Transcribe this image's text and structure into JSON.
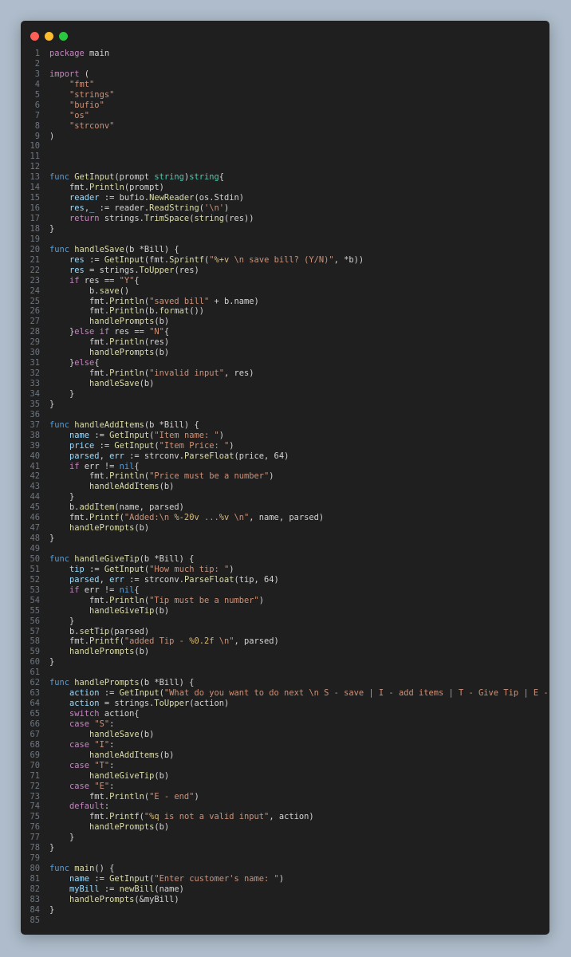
{
  "window": {
    "buttons": [
      {
        "name": "close-button",
        "color": "#ff5f57"
      },
      {
        "name": "minimize-button",
        "color": "#febc2e"
      },
      {
        "name": "maximize-button",
        "color": "#28c840"
      }
    ]
  },
  "code": {
    "lines": [
      [
        [
          "k",
          "package"
        ],
        [
          "p",
          " main"
        ]
      ],
      [],
      [
        [
          "k",
          "import"
        ],
        [
          "p",
          " ("
        ]
      ],
      [
        [
          "p",
          "    "
        ],
        [
          "s",
          "\"fmt\""
        ]
      ],
      [
        [
          "p",
          "    "
        ],
        [
          "s",
          "\"strings\""
        ]
      ],
      [
        [
          "p",
          "    "
        ],
        [
          "s",
          "\"bufio\""
        ]
      ],
      [
        [
          "p",
          "    "
        ],
        [
          "s",
          "\"os\""
        ]
      ],
      [
        [
          "p",
          "    "
        ],
        [
          "s",
          "\"strconv\""
        ]
      ],
      [
        [
          "p",
          ")"
        ]
      ],
      [],
      [],
      [],
      [
        [
          "b",
          "func"
        ],
        [
          "p",
          " "
        ],
        [
          "f",
          "GetInput"
        ],
        [
          "p",
          "(prompt "
        ],
        [
          "t",
          "string"
        ],
        [
          "p",
          ")"
        ],
        [
          "t",
          "string"
        ],
        [
          "p",
          "{"
        ]
      ],
      [
        [
          "p",
          "    fmt."
        ],
        [
          "f",
          "Println"
        ],
        [
          "p",
          "(prompt)"
        ]
      ],
      [
        [
          "p",
          "    "
        ],
        [
          "v",
          "reader"
        ],
        [
          "p",
          " := bufio."
        ],
        [
          "f",
          "NewReader"
        ],
        [
          "p",
          "(os.Stdin)"
        ]
      ],
      [
        [
          "p",
          "    "
        ],
        [
          "v",
          "res"
        ],
        [
          "p",
          ","
        ],
        [
          "v",
          "_"
        ],
        [
          "p",
          " := reader."
        ],
        [
          "f",
          "ReadString"
        ],
        [
          "p",
          "("
        ],
        [
          "s",
          "'\\n'"
        ],
        [
          "p",
          ")"
        ]
      ],
      [
        [
          "p",
          "    "
        ],
        [
          "k",
          "return"
        ],
        [
          "p",
          " strings."
        ],
        [
          "f",
          "TrimSpace"
        ],
        [
          "p",
          "("
        ],
        [
          "f",
          "string"
        ],
        [
          "p",
          "(res))"
        ]
      ],
      [
        [
          "p",
          "}"
        ]
      ],
      [],
      [
        [
          "b",
          "func"
        ],
        [
          "p",
          " "
        ],
        [
          "f",
          "handleSave"
        ],
        [
          "p",
          "(b *Bill) {"
        ]
      ],
      [
        [
          "p",
          "    "
        ],
        [
          "v",
          "res"
        ],
        [
          "p",
          " := "
        ],
        [
          "f",
          "GetInput"
        ],
        [
          "p",
          "(fmt."
        ],
        [
          "f",
          "Sprintf"
        ],
        [
          "p",
          "("
        ],
        [
          "s",
          "\""
        ],
        [
          "e",
          "%+v"
        ],
        [
          "s",
          " \\n save bill? (Y/N)\""
        ],
        [
          "p",
          ", *b))"
        ]
      ],
      [
        [
          "p",
          "    "
        ],
        [
          "v",
          "res"
        ],
        [
          "p",
          " = strings."
        ],
        [
          "f",
          "ToUpper"
        ],
        [
          "p",
          "(res)"
        ]
      ],
      [
        [
          "p",
          "    "
        ],
        [
          "k",
          "if"
        ],
        [
          "p",
          " res == "
        ],
        [
          "s",
          "\"Y\""
        ],
        [
          "p",
          "{"
        ]
      ],
      [
        [
          "p",
          "        b."
        ],
        [
          "f",
          "save"
        ],
        [
          "p",
          "()"
        ]
      ],
      [
        [
          "p",
          "        fmt."
        ],
        [
          "f",
          "Println"
        ],
        [
          "p",
          "("
        ],
        [
          "s",
          "\"saved bill\""
        ],
        [
          "p",
          " + b.name)"
        ]
      ],
      [
        [
          "p",
          "        fmt."
        ],
        [
          "f",
          "Println"
        ],
        [
          "p",
          "(b."
        ],
        [
          "f",
          "format"
        ],
        [
          "p",
          "())"
        ]
      ],
      [
        [
          "p",
          "        "
        ],
        [
          "f",
          "handlePrompts"
        ],
        [
          "p",
          "(b)"
        ]
      ],
      [
        [
          "p",
          "    }"
        ],
        [
          "k",
          "else"
        ],
        [
          "p",
          " "
        ],
        [
          "k",
          "if"
        ],
        [
          "p",
          " res == "
        ],
        [
          "s",
          "\"N\""
        ],
        [
          "p",
          "{"
        ]
      ],
      [
        [
          "p",
          "        fmt."
        ],
        [
          "f",
          "Println"
        ],
        [
          "p",
          "(res)"
        ]
      ],
      [
        [
          "p",
          "        "
        ],
        [
          "f",
          "handlePrompts"
        ],
        [
          "p",
          "(b)"
        ]
      ],
      [
        [
          "p",
          "    }"
        ],
        [
          "k",
          "else"
        ],
        [
          "p",
          "{"
        ]
      ],
      [
        [
          "p",
          "        fmt."
        ],
        [
          "f",
          "Println"
        ],
        [
          "p",
          "("
        ],
        [
          "s",
          "\"invalid input\""
        ],
        [
          "p",
          ", res)"
        ]
      ],
      [
        [
          "p",
          "        "
        ],
        [
          "f",
          "handleSave"
        ],
        [
          "p",
          "(b)"
        ]
      ],
      [
        [
          "p",
          "    }"
        ]
      ],
      [
        [
          "p",
          "}"
        ]
      ],
      [],
      [
        [
          "b",
          "func"
        ],
        [
          "p",
          " "
        ],
        [
          "f",
          "handleAddItems"
        ],
        [
          "p",
          "(b *Bill) {"
        ]
      ],
      [
        [
          "p",
          "    "
        ],
        [
          "v",
          "name"
        ],
        [
          "p",
          " := "
        ],
        [
          "f",
          "GetInput"
        ],
        [
          "p",
          "("
        ],
        [
          "s",
          "\"Item name: \""
        ],
        [
          "p",
          ")"
        ]
      ],
      [
        [
          "p",
          "    "
        ],
        [
          "v",
          "price"
        ],
        [
          "p",
          " := "
        ],
        [
          "f",
          "GetInput"
        ],
        [
          "p",
          "("
        ],
        [
          "s",
          "\"Item Price: \""
        ],
        [
          "p",
          ")"
        ]
      ],
      [
        [
          "p",
          "    "
        ],
        [
          "v",
          "parsed"
        ],
        [
          "p",
          ", "
        ],
        [
          "v",
          "err"
        ],
        [
          "p",
          " := strconv."
        ],
        [
          "f",
          "ParseFloat"
        ],
        [
          "p",
          "(price, 64)"
        ]
      ],
      [
        [
          "p",
          "    "
        ],
        [
          "k",
          "if"
        ],
        [
          "p",
          " err != "
        ],
        [
          "b",
          "nil"
        ],
        [
          "p",
          "{"
        ]
      ],
      [
        [
          "p",
          "        fmt."
        ],
        [
          "f",
          "Println"
        ],
        [
          "p",
          "("
        ],
        [
          "s",
          "\"Price must be a number\""
        ],
        [
          "p",
          ")"
        ]
      ],
      [
        [
          "p",
          "        "
        ],
        [
          "f",
          "handleAddItems"
        ],
        [
          "p",
          "(b)"
        ]
      ],
      [
        [
          "p",
          "    }"
        ]
      ],
      [
        [
          "p",
          "    b."
        ],
        [
          "f",
          "addItem"
        ],
        [
          "p",
          "(name, parsed)"
        ]
      ],
      [
        [
          "p",
          "    fmt."
        ],
        [
          "f",
          "Printf"
        ],
        [
          "p",
          "("
        ],
        [
          "s",
          "\"Added:\\n "
        ],
        [
          "e",
          "%-20v"
        ],
        [
          "s",
          " ..."
        ],
        [
          "e",
          "%v"
        ],
        [
          "s",
          " \\n\""
        ],
        [
          "p",
          ", name, parsed)"
        ]
      ],
      [
        [
          "p",
          "    "
        ],
        [
          "f",
          "handlePrompts"
        ],
        [
          "p",
          "(b)"
        ]
      ],
      [
        [
          "p",
          "}"
        ]
      ],
      [],
      [
        [
          "b",
          "func"
        ],
        [
          "p",
          " "
        ],
        [
          "f",
          "handleGiveTip"
        ],
        [
          "p",
          "(b *Bill) {"
        ]
      ],
      [
        [
          "p",
          "    "
        ],
        [
          "v",
          "tip"
        ],
        [
          "p",
          " := "
        ],
        [
          "f",
          "GetInput"
        ],
        [
          "p",
          "("
        ],
        [
          "s",
          "\"How much tip: \""
        ],
        [
          "p",
          ")"
        ]
      ],
      [
        [
          "p",
          "    "
        ],
        [
          "v",
          "parsed"
        ],
        [
          "p",
          ", "
        ],
        [
          "v",
          "err"
        ],
        [
          "p",
          " := strconv."
        ],
        [
          "f",
          "ParseFloat"
        ],
        [
          "p",
          "(tip, 64)"
        ]
      ],
      [
        [
          "p",
          "    "
        ],
        [
          "k",
          "if"
        ],
        [
          "p",
          " err != "
        ],
        [
          "b",
          "nil"
        ],
        [
          "p",
          "{"
        ]
      ],
      [
        [
          "p",
          "        fmt."
        ],
        [
          "f",
          "Println"
        ],
        [
          "p",
          "("
        ],
        [
          "s",
          "\"Tip must be a number\""
        ],
        [
          "p",
          ")"
        ]
      ],
      [
        [
          "p",
          "        "
        ],
        [
          "f",
          "handleGiveTip"
        ],
        [
          "p",
          "(b)"
        ]
      ],
      [
        [
          "p",
          "    }"
        ]
      ],
      [
        [
          "p",
          "    b."
        ],
        [
          "f",
          "setTip"
        ],
        [
          "p",
          "(parsed)"
        ]
      ],
      [
        [
          "p",
          "    fmt."
        ],
        [
          "f",
          "Printf"
        ],
        [
          "p",
          "("
        ],
        [
          "s",
          "\"added Tip - "
        ],
        [
          "e",
          "%0.2f"
        ],
        [
          "s",
          " \\n\""
        ],
        [
          "p",
          ", parsed)"
        ]
      ],
      [
        [
          "p",
          "    "
        ],
        [
          "f",
          "handlePrompts"
        ],
        [
          "p",
          "(b)"
        ]
      ],
      [
        [
          "p",
          "}"
        ]
      ],
      [],
      [
        [
          "b",
          "func"
        ],
        [
          "p",
          " "
        ],
        [
          "f",
          "handlePrompts"
        ],
        [
          "p",
          "(b *Bill) {"
        ]
      ],
      [
        [
          "p",
          "    "
        ],
        [
          "v",
          "action"
        ],
        [
          "p",
          " := "
        ],
        [
          "f",
          "GetInput"
        ],
        [
          "p",
          "("
        ],
        [
          "s",
          "\"What do you want to do next \\n S - save | I - add items | T - Give Tip | E - end\""
        ],
        [
          "p",
          ")"
        ]
      ],
      [
        [
          "p",
          "    "
        ],
        [
          "v",
          "action"
        ],
        [
          "p",
          " = strings."
        ],
        [
          "f",
          "ToUpper"
        ],
        [
          "p",
          "(action)"
        ]
      ],
      [
        [
          "p",
          "    "
        ],
        [
          "k",
          "switch"
        ],
        [
          "p",
          " action{"
        ]
      ],
      [
        [
          "p",
          "    "
        ],
        [
          "k",
          "case"
        ],
        [
          "p",
          " "
        ],
        [
          "s",
          "\"S\""
        ],
        [
          "p",
          ":"
        ]
      ],
      [
        [
          "p",
          "        "
        ],
        [
          "f",
          "handleSave"
        ],
        [
          "p",
          "(b)"
        ]
      ],
      [
        [
          "p",
          "    "
        ],
        [
          "k",
          "case"
        ],
        [
          "p",
          " "
        ],
        [
          "s",
          "\"I\""
        ],
        [
          "p",
          ":"
        ]
      ],
      [
        [
          "p",
          "        "
        ],
        [
          "f",
          "handleAddItems"
        ],
        [
          "p",
          "(b)"
        ]
      ],
      [
        [
          "p",
          "    "
        ],
        [
          "k",
          "case"
        ],
        [
          "p",
          " "
        ],
        [
          "s",
          "\"T\""
        ],
        [
          "p",
          ":"
        ]
      ],
      [
        [
          "p",
          "        "
        ],
        [
          "f",
          "handleGiveTip"
        ],
        [
          "p",
          "(b)"
        ]
      ],
      [
        [
          "p",
          "    "
        ],
        [
          "k",
          "case"
        ],
        [
          "p",
          " "
        ],
        [
          "s",
          "\"E\""
        ],
        [
          "p",
          ":"
        ]
      ],
      [
        [
          "p",
          "        fmt."
        ],
        [
          "f",
          "Println"
        ],
        [
          "p",
          "("
        ],
        [
          "s",
          "\"E - end\""
        ],
        [
          "p",
          ")"
        ]
      ],
      [
        [
          "p",
          "    "
        ],
        [
          "k",
          "default"
        ],
        [
          "p",
          ":"
        ]
      ],
      [
        [
          "p",
          "        fmt."
        ],
        [
          "f",
          "Printf"
        ],
        [
          "p",
          "("
        ],
        [
          "s",
          "\""
        ],
        [
          "e",
          "%q"
        ],
        [
          "s",
          " is not a valid input\""
        ],
        [
          "p",
          ", action)"
        ]
      ],
      [
        [
          "p",
          "        "
        ],
        [
          "f",
          "handlePrompts"
        ],
        [
          "p",
          "(b)"
        ]
      ],
      [
        [
          "p",
          "    }"
        ]
      ],
      [
        [
          "p",
          "}"
        ]
      ],
      [],
      [
        [
          "b",
          "func"
        ],
        [
          "p",
          " "
        ],
        [
          "f",
          "main"
        ],
        [
          "p",
          "() {"
        ]
      ],
      [
        [
          "p",
          "    "
        ],
        [
          "v",
          "name"
        ],
        [
          "p",
          " := "
        ],
        [
          "f",
          "GetInput"
        ],
        [
          "p",
          "("
        ],
        [
          "s",
          "\"Enter customer's name: \""
        ],
        [
          "p",
          ")"
        ]
      ],
      [
        [
          "p",
          "    "
        ],
        [
          "v",
          "myBill"
        ],
        [
          "p",
          " := "
        ],
        [
          "f",
          "newBill"
        ],
        [
          "p",
          "(name)"
        ]
      ],
      [
        [
          "p",
          "    "
        ],
        [
          "f",
          "handlePrompts"
        ],
        [
          "p",
          "(&myBill)"
        ]
      ],
      [
        [
          "p",
          "}"
        ]
      ],
      []
    ]
  }
}
